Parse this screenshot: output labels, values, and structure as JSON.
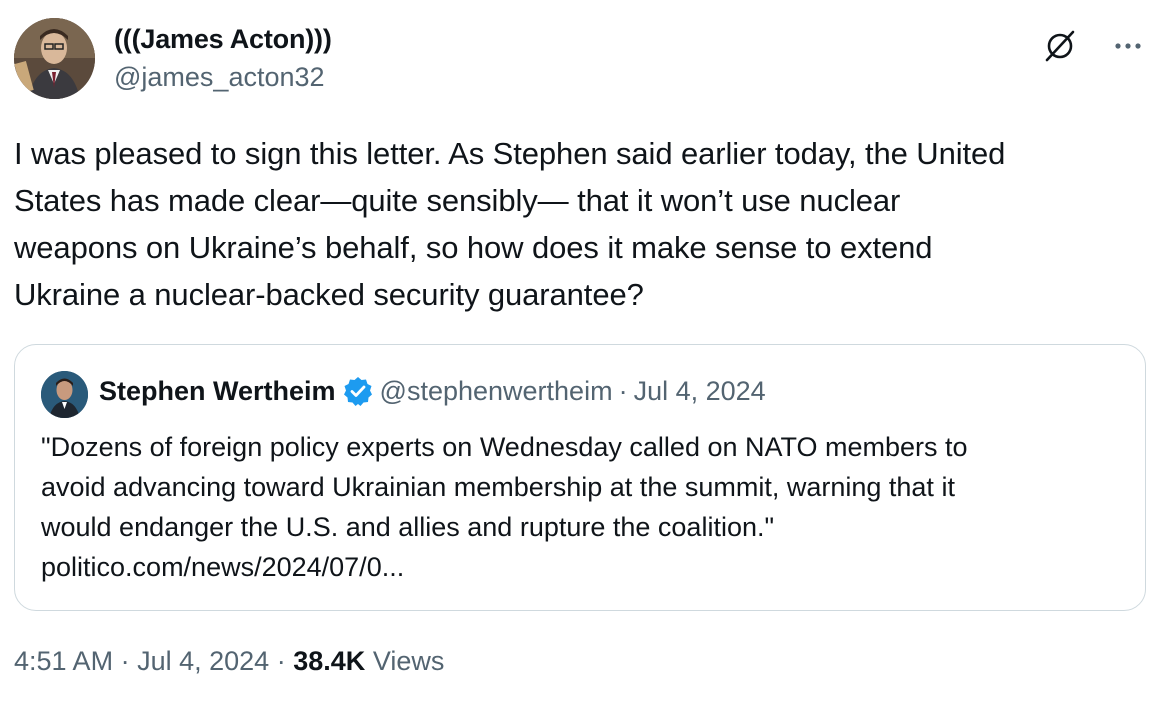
{
  "author": {
    "name": "(((James Acton)))",
    "handle": "@james_acton32",
    "avatar_icon": "user-avatar-photo"
  },
  "icons": {
    "grok": "grok-icon",
    "more": "more-dots-icon",
    "verified": "verified-badge-icon",
    "verified_color": "#1d9bf0"
  },
  "tweet": {
    "text_lines": [
      "I was pleased to sign this letter. As Stephen said earlier today, the United",
      "States has made clear—quite sensibly— that it won’t use nuclear",
      "weapons on Ukraine’s behalf, so how does it make sense to extend",
      "Ukraine a nuclear-backed security guarantee?"
    ]
  },
  "quote": {
    "name": "Stephen Wertheim",
    "handle": "@stephenwertheim",
    "separator": "·",
    "date": "Jul 4, 2024",
    "text_lines": [
      "\"Dozens of foreign policy experts on Wednesday called on NATO members to",
      "avoid advancing toward Ukrainian membership at the summit, warning that it",
      "would endanger the U.S. and allies and rupture the coalition.\""
    ],
    "link": "politico.com/news/2024/07/0..."
  },
  "footer": {
    "time": "4:51 AM",
    "sep1": "·",
    "date": "Jul 4, 2024",
    "sep2": "·",
    "views_count": "38.4K",
    "views_label": "Views"
  }
}
